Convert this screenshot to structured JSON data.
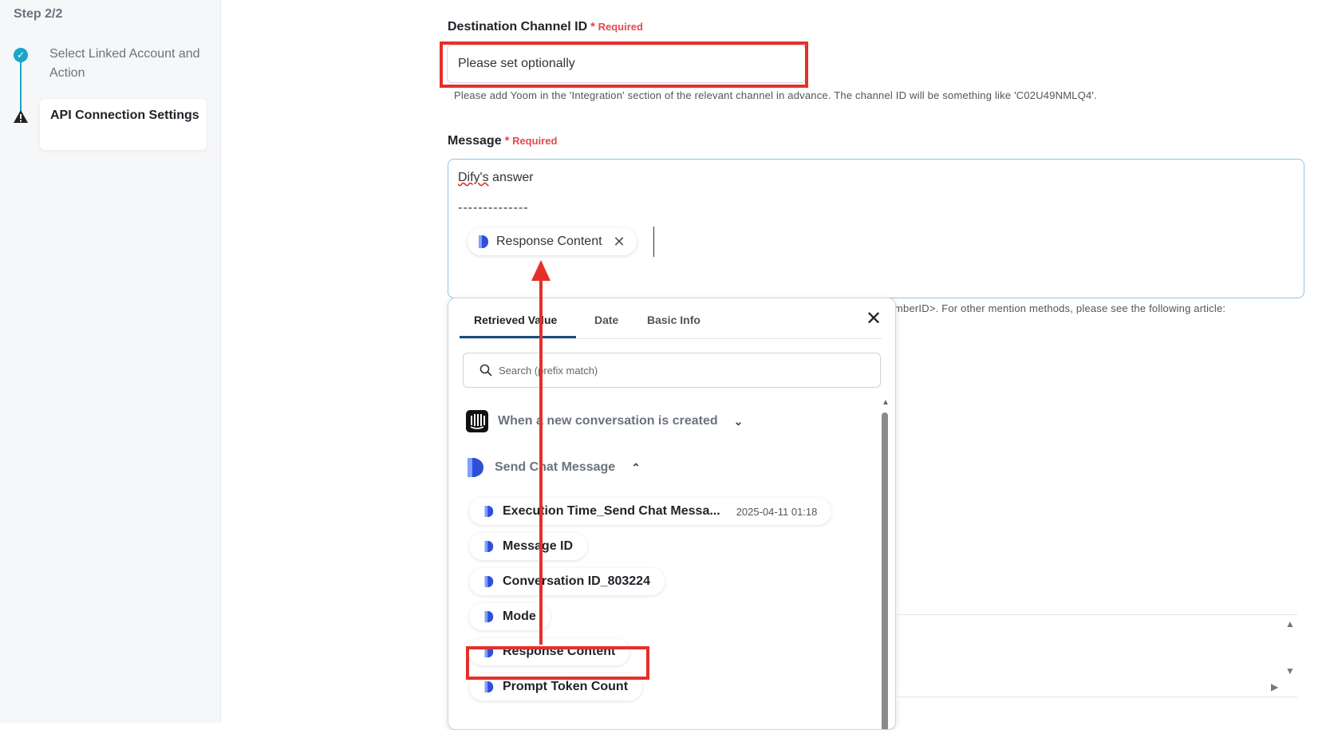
{
  "sidebar": {
    "step_title": "Step 2/2",
    "steps": [
      {
        "label": "Select Linked Account and Action",
        "status": "done"
      },
      {
        "label": "API Connection Settings",
        "status": "warning"
      }
    ]
  },
  "channel": {
    "label": "Destination Channel ID",
    "required": "Required",
    "placeholder": "Please set optionally",
    "help": "Please add Yoom in the 'Integration' section of the relevant channel in advance. The channel ID will be something like 'C02U49NMLQ4'."
  },
  "message": {
    "label": "Message",
    "required": "Required",
    "line1_word": "Dify's",
    "line1_rest": " answer",
    "line2": "--------------",
    "chip_label": "Response Content",
    "help_partial": "mberID>. For other mention methods, please see the following article:"
  },
  "panel": {
    "tabs": [
      "Retrieved Value",
      "Date",
      "Basic Info"
    ],
    "search_placeholder": "Search (prefix match)",
    "groups": [
      {
        "label": "When a new conversation is created",
        "icon": "intercom-icon",
        "expanded": false
      },
      {
        "label": "Send Chat Message",
        "icon": "dify-icon",
        "expanded": true
      }
    ],
    "items": [
      {
        "label": "Execution Time_Send Chat Messa...",
        "value": "2025-04-11 01:18"
      },
      {
        "label": "Message ID",
        "value": ""
      },
      {
        "label": "Conversation ID_803224",
        "value": ""
      },
      {
        "label": "Mode",
        "value": ""
      },
      {
        "label": "Response Content",
        "value": ""
      },
      {
        "label": "Prompt Token Count",
        "value": ""
      }
    ]
  },
  "colors": {
    "accent": "#1aa5c9",
    "highlight": "#e5302a",
    "required": "#e5484d"
  }
}
